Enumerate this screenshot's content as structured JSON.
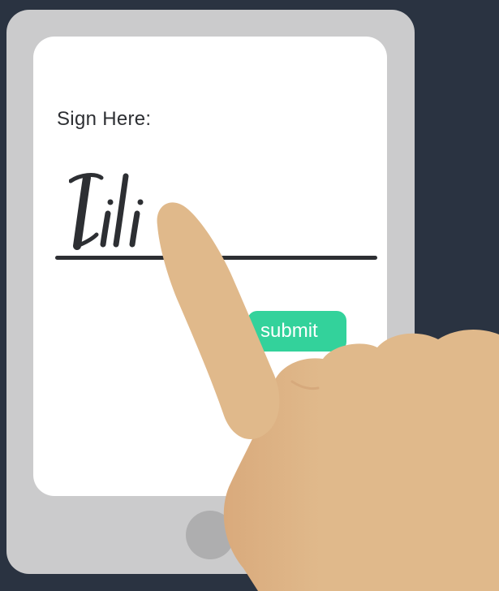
{
  "prompt": {
    "label": "Sign Here:"
  },
  "signature": {
    "text": "Lili"
  },
  "actions": {
    "submit_label": "submit"
  },
  "colors": {
    "background": "#2a3341",
    "device": "#cbcbcc",
    "screen": "#ffffff",
    "text": "#2d2f33",
    "submit": "#33d29b",
    "skin": "#e0b98b"
  },
  "icons": {
    "hand": "pointing-hand-icon",
    "home": "home-button"
  }
}
